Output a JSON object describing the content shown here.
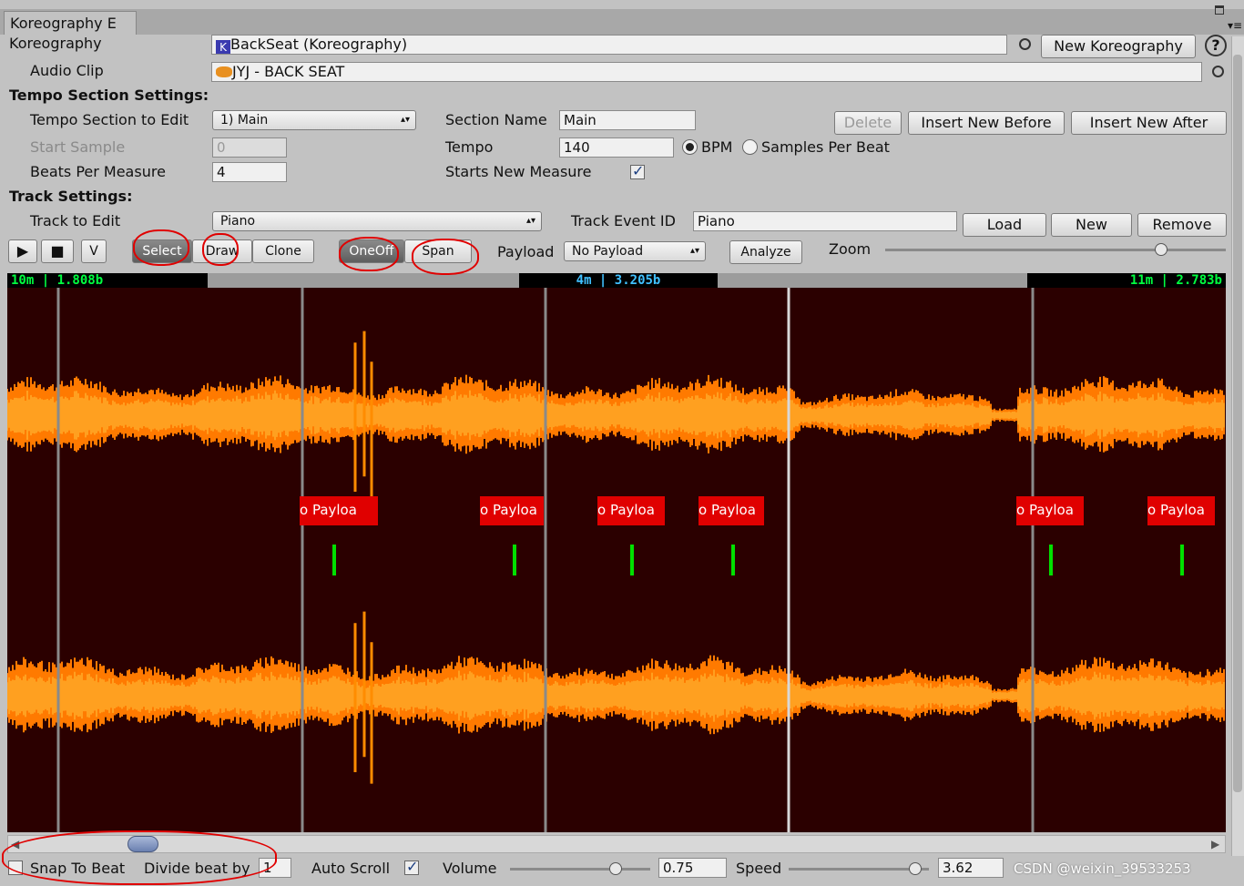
{
  "window": {
    "tab_title": "Koreography E",
    "colors": {
      "background": "#c2c2c2",
      "wave_bg": "#2b0000",
      "wave_orange": "#ff8c00",
      "payload_red": "#e00000",
      "beat_green": "#00e000"
    }
  },
  "koreography": {
    "label": "Koreography",
    "value": "BackSeat (Koreography)",
    "new_button": "New Koreography",
    "help": "?"
  },
  "audio_clip": {
    "label": "Audio Clip",
    "value": "JYJ - BACK SEAT"
  },
  "tempo": {
    "heading": "Tempo Section Settings:",
    "section_to_edit_label": "Tempo Section to Edit",
    "section_to_edit_value": "1) Main",
    "start_sample_label": "Start Sample",
    "start_sample_value": "0",
    "beats_label": "Beats Per Measure",
    "beats_value": "4",
    "section_name_label": "Section Name",
    "section_name_value": "Main",
    "tempo_label": "Tempo",
    "tempo_value": "140",
    "bpm_label": "BPM",
    "spb_label": "Samples Per Beat",
    "starts_new_measure_label": "Starts New Measure",
    "delete": "Delete",
    "insert_before": "Insert New Before",
    "insert_after": "Insert New After"
  },
  "track": {
    "heading": "Track Settings:",
    "to_edit_label": "Track to Edit",
    "to_edit_value": "Piano",
    "event_id_label": "Track Event ID",
    "event_id_value": "Piano",
    "load": "Load",
    "new": "New",
    "remove": "Remove"
  },
  "toolbar": {
    "play": "▶",
    "stop": "■",
    "v": "V",
    "select": "Select",
    "draw": "Draw",
    "clone": "Clone",
    "oneoff": "OneOff",
    "span": "Span",
    "payload_label": "Payload",
    "payload_value": "No Payload",
    "analyze": "Analyze",
    "zoom_label": "Zoom",
    "zoom_level": 0.81
  },
  "waveform": {
    "left_pos": "10m | 1.808b",
    "center_pos": "4m | 3.205b",
    "right_pos": "11m | 2.783b",
    "event_label": "o Payloa",
    "scroll_position": 0.09
  },
  "bottom": {
    "snap_label": "Snap To Beat",
    "divide_label": "Divide beat by",
    "divide_value": "1",
    "auto_scroll_label": "Auto Scroll",
    "volume_label": "Volume",
    "volume_value": "0.75",
    "volume_level": 0.75,
    "speed_label": "Speed",
    "speed_value": "3.62",
    "speed_level": 0.9,
    "watermark": "CSDN @weixin_39533253"
  }
}
